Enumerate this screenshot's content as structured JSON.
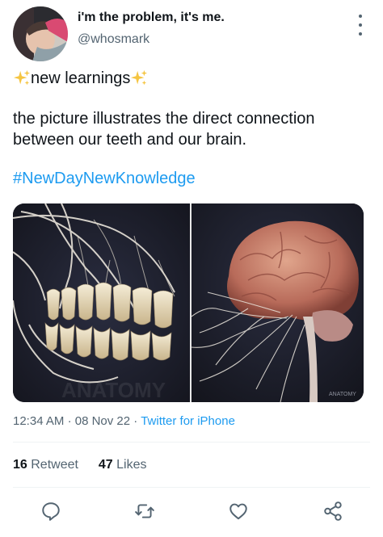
{
  "author": {
    "display_name": "i'm the problem, it's me.",
    "handle": "@whosmark"
  },
  "tweet": {
    "line1_text": "new learnings",
    "body": "the picture illustrates the direct connection between our teeth and our brain.",
    "hashtag": "#NewDayNewKnowledge"
  },
  "media": {
    "watermark": "ANATOMY"
  },
  "meta": {
    "time": "12:34 AM",
    "dot": "·",
    "date": "08 Nov 22",
    "source": "Twitter for iPhone"
  },
  "stats": {
    "retweet_count": "16",
    "retweet_label": "Retweet",
    "like_count": "47",
    "like_label": "Likes"
  },
  "icons": {
    "accent": "#1d9bf0",
    "icon_color": "#536471",
    "sparkle_color": "#f5c542"
  }
}
